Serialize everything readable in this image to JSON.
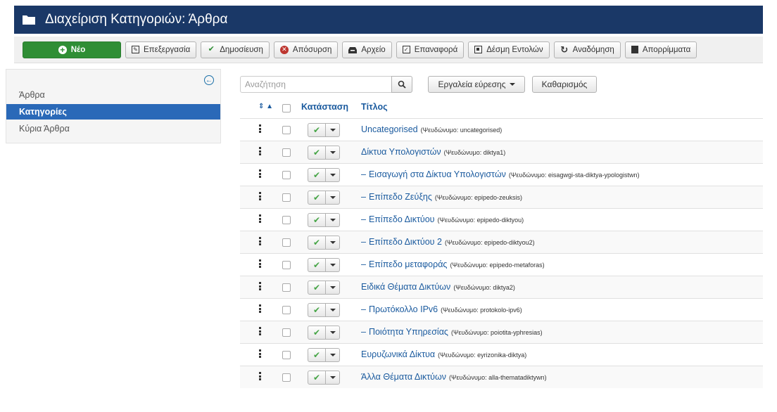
{
  "header": {
    "title": "Διαχείριση Κατηγοριών: Άρθρα",
    "icon": "folder-icon",
    "background": "#1a3867"
  },
  "toolbar": {
    "new_label": "Νέο",
    "edit_label": "Επεξεργασία",
    "publish_label": "Δημοσίευση",
    "unpublish_label": "Απόσυρση",
    "archive_label": "Αρχείο",
    "checkin_label": "Επαναφορά",
    "batch_label": "Δέσμη Εντολών",
    "rebuild_label": "Αναδόμηση",
    "trash_label": "Απορρίμματα",
    "new_color": "#2f8e35"
  },
  "sidebar": {
    "items": [
      {
        "label": "Άρθρα",
        "active": false
      },
      {
        "label": "Κατηγορίες",
        "active": true
      },
      {
        "label": "Κύρια Άρθρα",
        "active": false
      }
    ],
    "active_color": "#2a69b8"
  },
  "filters": {
    "search_placeholder": "Αναζήτηση",
    "search_tools_label": "Εργαλεία εύρεσης",
    "clear_label": "Καθαρισμός"
  },
  "table": {
    "columns": {
      "status": "Κατάσταση",
      "title": "Τίτλος"
    },
    "rows": [
      {
        "prefix": "",
        "title": "Uncategorised",
        "alias": "(Ψευδώνυμο: uncategorised)"
      },
      {
        "prefix": "",
        "title": "Δίκτυα Υπολογιστών",
        "alias": "(Ψευδώνυμο: diktya1)"
      },
      {
        "prefix": "–",
        "title": "Εισαγωγή στα Δίκτυα Υπολογιστών",
        "alias": "(Ψευδώνυμο: eisagwgi-sta-diktya-ypologistwn)"
      },
      {
        "prefix": "–",
        "title": "Επίπεδο Ζεύξης",
        "alias": "(Ψευδώνυμο: epipedo-zeuksis)"
      },
      {
        "prefix": "–",
        "title": "Επίπεδο Δικτύου",
        "alias": "(Ψευδώνυμο: epipedo-diktyou)"
      },
      {
        "prefix": "–",
        "title": "Επίπεδο Δικτύου 2",
        "alias": "(Ψευδώνυμο: epipedo-diktyou2)"
      },
      {
        "prefix": "–",
        "title": "Επίπεδο μεταφοράς",
        "alias": "(Ψευδώνυμο: epipedo-metaforas)"
      },
      {
        "prefix": "",
        "title": "Ειδικά Θέματα Δικτύων",
        "alias": "(Ψευδώνυμο: diktya2)"
      },
      {
        "prefix": "–",
        "title": "Πρωτόκολλο IPv6",
        "alias": "(Ψευδώνυμο: protokolo-ipv6)"
      },
      {
        "prefix": "–",
        "title": "Ποιότητα Υπηρεσίας",
        "alias": "(Ψευδώνυμο: poiotita-yphresias)"
      },
      {
        "prefix": "",
        "title": "Ευρυζωνικά Δίκτυα",
        "alias": "(Ψευδώνυμο: eyrizonika-diktya)"
      },
      {
        "prefix": "",
        "title": "Άλλα Θέματα Δικτύων",
        "alias": "(Ψευδώνυμο: alla-thematadiktywn)"
      }
    ]
  }
}
